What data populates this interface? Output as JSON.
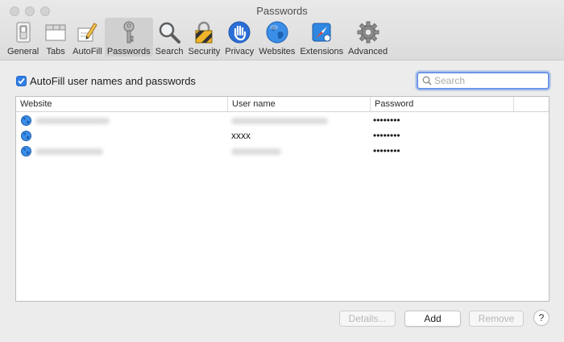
{
  "window": {
    "title": "Passwords"
  },
  "toolbar": {
    "items": [
      {
        "label": "General",
        "icon": "switch-icon"
      },
      {
        "label": "Tabs",
        "icon": "tabs-icon"
      },
      {
        "label": "AutoFill",
        "icon": "pencil-form-icon"
      },
      {
        "label": "Passwords",
        "icon": "key-icon",
        "selected": true
      },
      {
        "label": "Search",
        "icon": "magnifier-icon"
      },
      {
        "label": "Security",
        "icon": "lock-icon"
      },
      {
        "label": "Privacy",
        "icon": "hand-icon"
      },
      {
        "label": "Websites",
        "icon": "globe-icon"
      },
      {
        "label": "Extensions",
        "icon": "puzzle-compass-icon"
      },
      {
        "label": "Advanced",
        "icon": "gear-icon"
      }
    ]
  },
  "autofill": {
    "label": "AutoFill user names and passwords",
    "checked": true
  },
  "search": {
    "placeholder": "Search"
  },
  "table": {
    "columns": [
      "Website",
      "User name",
      "Password"
    ],
    "rows": [
      {
        "website": "",
        "username": "",
        "password": "••••••••"
      },
      {
        "website": "",
        "username": "xxxx",
        "password": "••••••••"
      },
      {
        "website": "",
        "username": "",
        "password": "••••••••"
      }
    ]
  },
  "buttons": {
    "details": "Details...",
    "add": "Add",
    "remove": "Remove",
    "help": "?"
  },
  "colors": {
    "accent": "#2f7ee8",
    "focus_ring": "#6d97e6",
    "window_bg": "#ececec"
  }
}
